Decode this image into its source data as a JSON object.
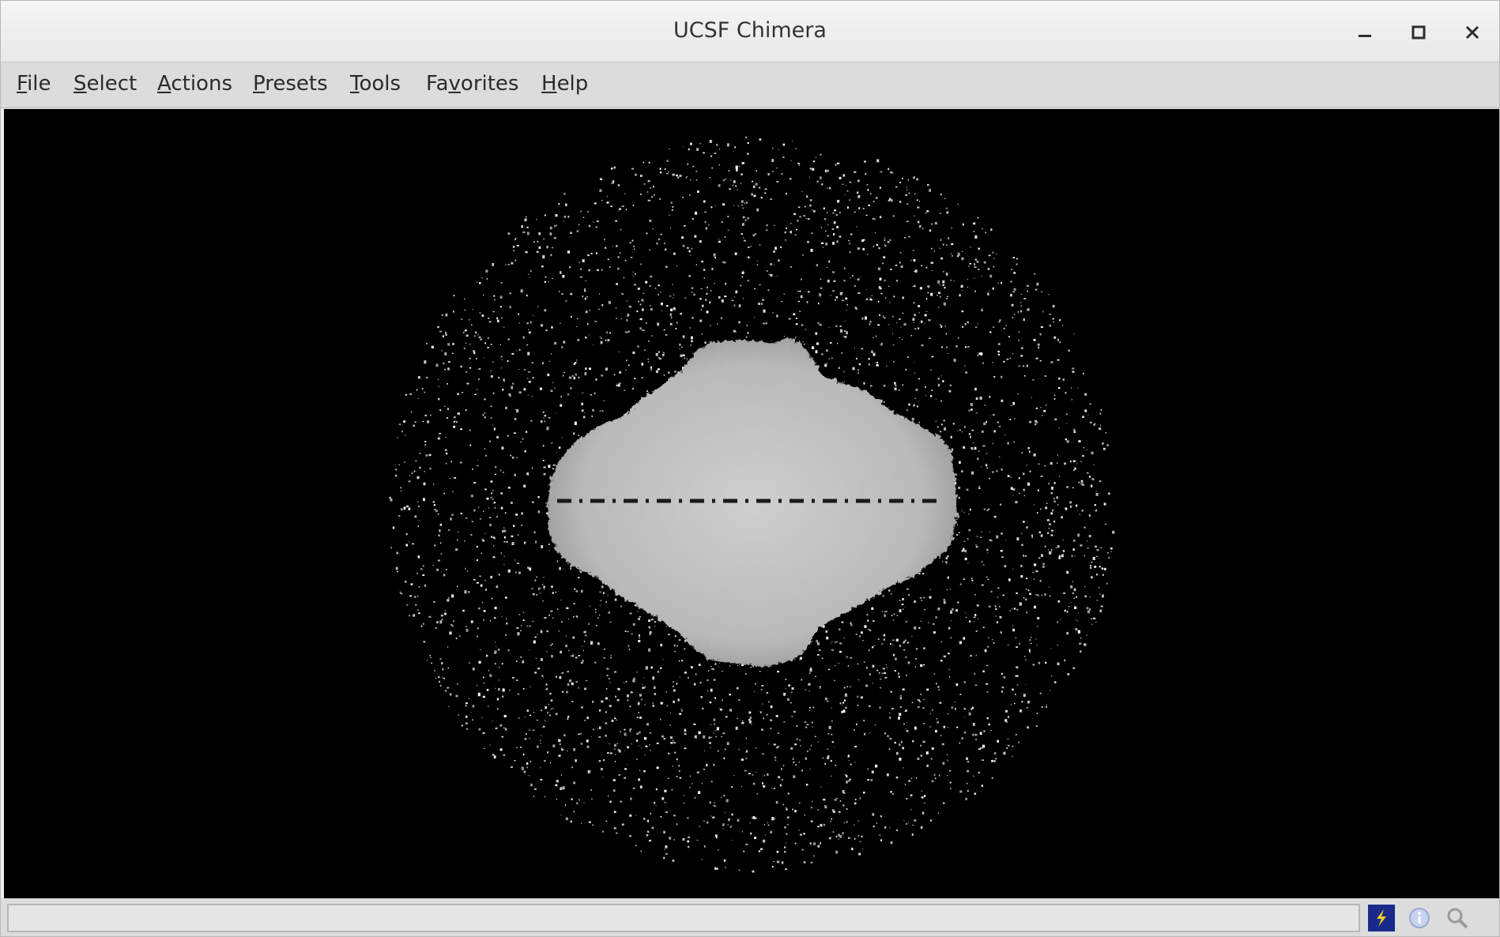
{
  "window": {
    "title": "UCSF Chimera"
  },
  "title_buttons": [
    {
      "name": "minimize-button",
      "icon": "minimize-icon"
    },
    {
      "name": "maximize-button",
      "icon": "maximize-icon"
    },
    {
      "name": "close-button",
      "icon": "close-icon"
    }
  ],
  "menubar": {
    "items": [
      {
        "label": "File",
        "mnemonic": "F"
      },
      {
        "label": "Select",
        "mnemonic": "S"
      },
      {
        "label": "Actions",
        "mnemonic": "A"
      },
      {
        "label": "Presets",
        "mnemonic": "P"
      },
      {
        "label": "Tools",
        "mnemonic": "T"
      },
      {
        "label": "Favorites",
        "mnemonic": "v"
      },
      {
        "label": "Help",
        "mnemonic": "H"
      }
    ]
  },
  "viewer": {
    "background_color": "#000000",
    "surface_color": "#d0d0d0",
    "content": "cryo-EM density map volume rendering"
  },
  "statusbar": {
    "message": "",
    "icons": [
      {
        "name": "command-line-icon",
        "color": "#1a2a8a"
      },
      {
        "name": "info-icon",
        "color": "#9aa8d8"
      },
      {
        "name": "zoom-icon",
        "color": "#9a9a9a"
      }
    ]
  }
}
